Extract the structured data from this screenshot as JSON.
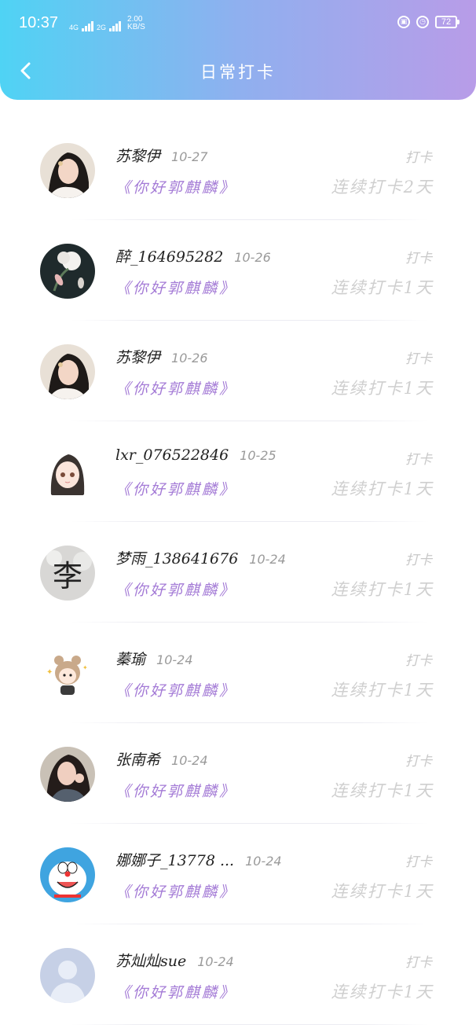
{
  "status_bar": {
    "time": "10:37",
    "net_4g": "4G",
    "net_2g": "2G",
    "speed_value": "2.00",
    "speed_unit": "KB/S",
    "battery": "72"
  },
  "header": {
    "title": "日常打卡"
  },
  "colors": {
    "gradient_start": "#4fd3f4",
    "gradient_end": "#b89ce8",
    "topic": "#a47bd6"
  },
  "checkins": [
    {
      "name": "苏黎伊",
      "date": "10-27",
      "topic": "《你好郭麒麟》",
      "label": "打卡",
      "streak": "连续打卡2天",
      "avatar": "girl-photo-avatar"
    },
    {
      "name": "醉_164695282",
      "date": "10-26",
      "topic": "《你好郭麒麟》",
      "label": "打卡",
      "streak": "连续打卡1天",
      "avatar": "flower-avatar"
    },
    {
      "name": "苏黎伊",
      "date": "10-26",
      "topic": "《你好郭麒麟》",
      "label": "打卡",
      "streak": "连续打卡1天",
      "avatar": "girl-photo-avatar"
    },
    {
      "name": "lxr_076522846",
      "date": "10-25",
      "topic": "《你好郭麒麟》",
      "label": "打卡",
      "streak": "连续打卡1天",
      "avatar": "anime-girl-avatar"
    },
    {
      "name": "梦雨_138641676",
      "date": "10-24",
      "topic": "《你好郭麒麟》",
      "label": "打卡",
      "streak": "连续打卡1天",
      "avatar": "li-character-avatar",
      "avatar_text": "李"
    },
    {
      "name": "蓁瑜",
      "date": "10-24",
      "topic": "《你好郭麒麟》",
      "label": "打卡",
      "streak": "连续打卡1天",
      "avatar": "bear-girl-avatar"
    },
    {
      "name": "张南希",
      "date": "10-24",
      "topic": "《你好郭麒麟》",
      "label": "打卡",
      "streak": "连续打卡1天",
      "avatar": "girl-photo-avatar-2"
    },
    {
      "name": "娜娜子_13778 ...",
      "date": "10-24",
      "topic": "《你好郭麒麟》",
      "label": "打卡",
      "streak": "连续打卡1天",
      "avatar": "doraemon-avatar"
    },
    {
      "name": "苏灿灿sue",
      "date": "10-24",
      "topic": "《你好郭麒麟》",
      "label": "打卡",
      "streak": "连续打卡1天",
      "avatar": "default-user-avatar"
    }
  ]
}
